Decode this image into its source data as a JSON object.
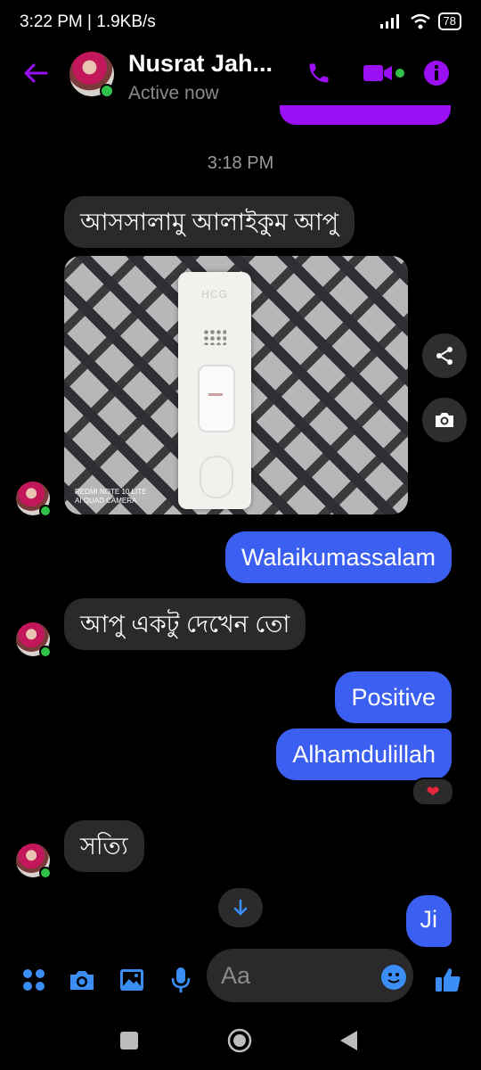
{
  "status_bar": {
    "time_speed": "3:22 PM | 1.9KB/s",
    "battery": "78"
  },
  "header": {
    "contact_name": "Nusrat Jah...",
    "active_status": "Active now"
  },
  "conversation": {
    "timestamp": "3:18 PM",
    "messages": [
      {
        "direction": "in",
        "text": "আসসালামু আলাইকুম আপু"
      },
      {
        "direction": "in",
        "type": "image",
        "watermark_line1": "REDMI NOTE 10 LITE",
        "watermark_line2": "AI QUAD CAMERA",
        "strip_label": "HCG"
      },
      {
        "direction": "out",
        "text": "Walaikumassalam"
      },
      {
        "direction": "in",
        "text": "আপু একটু দেখেন তো"
      },
      {
        "direction": "out",
        "text": "Positive"
      },
      {
        "direction": "out",
        "text": "Alhamdulillah",
        "reaction": "❤"
      },
      {
        "direction": "in",
        "text": "সত্যি"
      },
      {
        "direction": "out",
        "text": "Ji"
      }
    ]
  },
  "composer": {
    "placeholder": "Aa"
  },
  "colors": {
    "accent_purple": "#9b0ff5",
    "outgoing_bubble": "#3b5ff0",
    "incoming_bubble": "#2a2a2a",
    "icon_blue": "#3b8ef5",
    "online_green": "#31c14a"
  },
  "icons": [
    "back-arrow-icon",
    "phone-icon",
    "video-camera-icon",
    "info-icon",
    "share-icon",
    "camera-icon",
    "arrow-down-icon",
    "apps-icon",
    "gallery-icon",
    "microphone-icon",
    "emoji-icon",
    "thumbs-up-icon",
    "nav-recents-icon",
    "nav-home-icon",
    "nav-back-icon"
  ]
}
